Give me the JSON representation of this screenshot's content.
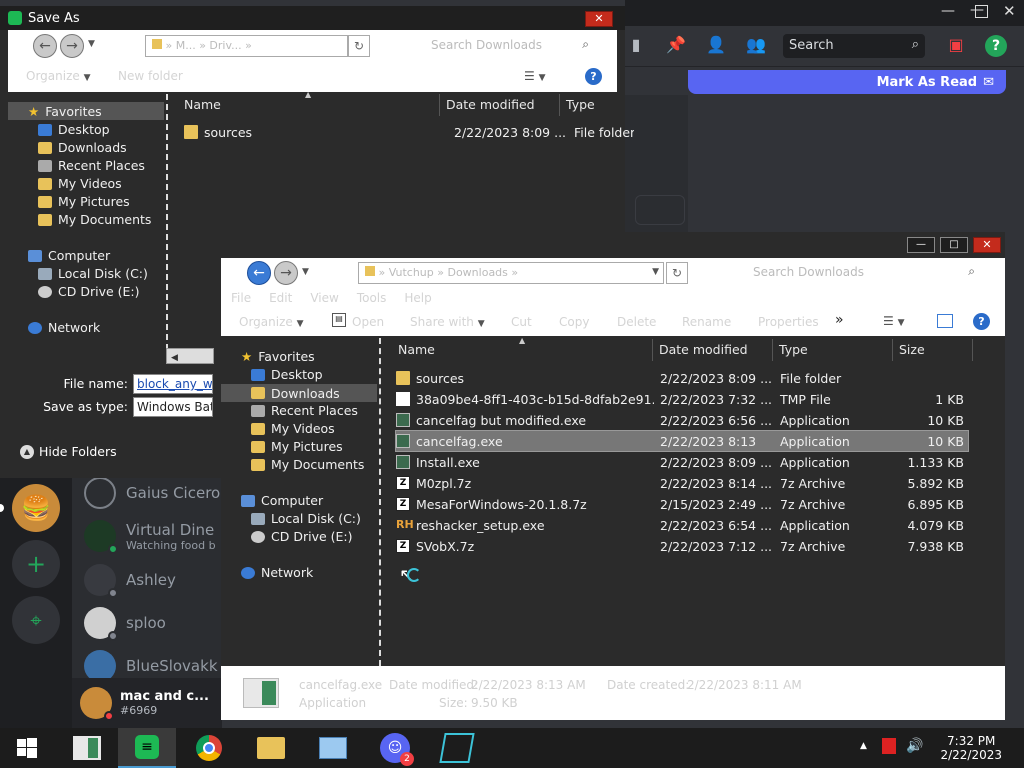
{
  "discord": {
    "search_placeholder": "Search",
    "mark_as_read": "Mark As Read",
    "dms": [
      {
        "name": "Gaius Cicero",
        "sub": ""
      },
      {
        "name": "Virtual Dine",
        "sub": "Watching food b"
      },
      {
        "name": "Ashley",
        "sub": ""
      },
      {
        "name": "sploo",
        "sub": ""
      },
      {
        "name": "BlueSlovakk",
        "sub": ""
      }
    ],
    "user": {
      "name": "mac and c...",
      "tag": "#6969"
    },
    "colors": {
      "accent": "#5865f2",
      "online": "#23a55a"
    }
  },
  "saveas": {
    "title": "Save As",
    "address": "» M... » Driv... »",
    "search_placeholder": "Search Downloads",
    "organize": "Organize",
    "new_folder": "New folder",
    "nav": {
      "favorites": "Favorites",
      "items": [
        "Desktop",
        "Downloads",
        "Recent Places",
        "My Videos",
        "My Pictures",
        "My Documents"
      ],
      "computer": "Computer",
      "drives": [
        "Local Disk (C:)",
        "CD Drive (E:)"
      ],
      "network": "Network"
    },
    "columns": {
      "name": "Name",
      "date": "Date modified",
      "type": "Type"
    },
    "files": [
      {
        "name": "sources",
        "date": "2/22/2023 8:09 ...",
        "type": "File folder"
      }
    ],
    "file_name_label": "File name:",
    "file_name_value": "block_any_we",
    "save_as_type_label": "Save as type:",
    "save_as_type_value": "Windows Batc",
    "hide_folders": "Hide Folders"
  },
  "explorer": {
    "address": "» Vutchup » Downloads »",
    "search_placeholder": "Search Downloads",
    "menu": [
      "File",
      "Edit",
      "View",
      "Tools",
      "Help"
    ],
    "toolbar": [
      "Organize",
      "Open",
      "Share with",
      "Cut",
      "Copy",
      "Delete",
      "Rename",
      "Properties"
    ],
    "more": "»",
    "nav": {
      "favorites": "Favorites",
      "items": [
        "Desktop",
        "Downloads",
        "Recent Places",
        "My Videos",
        "My Pictures",
        "My Documents"
      ],
      "computer": "Computer",
      "drives": [
        "Local Disk (C:)",
        "CD Drive (E:)"
      ],
      "network": "Network"
    },
    "columns": {
      "name": "Name",
      "date": "Date modified",
      "type": "Type",
      "size": "Size"
    },
    "files": [
      {
        "name": "sources",
        "date": "2/22/2023 8:09 ...",
        "type": "File folder",
        "size": "",
        "icon": "folder-icon"
      },
      {
        "name": "38a09be4-8ff1-403c-b15d-8dfab2e91...",
        "date": "2/22/2023 7:32 ...",
        "type": "TMP File",
        "size": "1 KB",
        "icon": "document-icon"
      },
      {
        "name": "cancelfag but modified.exe",
        "date": "2/22/2023 6:56 ...",
        "type": "Application",
        "size": "10 KB",
        "icon": "application-icon"
      },
      {
        "name": "cancelfag.exe",
        "date": "2/22/2023 8:13",
        "type": "Application",
        "size": "10 KB",
        "icon": "application-icon",
        "selected": true
      },
      {
        "name": "Install.exe",
        "date": "2/22/2023 8:09 ...",
        "type": "Application",
        "size": "1.133 KB",
        "icon": "application-icon"
      },
      {
        "name": "M0zpl.7z",
        "date": "2/22/2023 8:14 ...",
        "type": "7z Archive",
        "size": "5.892 KB",
        "icon": "archive-icon"
      },
      {
        "name": "MesaForWindows-20.1.8.7z",
        "date": "2/15/2023 2:49 ...",
        "type": "7z Archive",
        "size": "6.895 KB",
        "icon": "archive-icon"
      },
      {
        "name": "reshacker_setup.exe",
        "date": "2/22/2023 6:54 ...",
        "type": "Application",
        "size": "4.079 KB",
        "icon": "reshacker-icon"
      },
      {
        "name": "SVobX.7z",
        "date": "2/22/2023 7:12 ...",
        "type": "7z Archive",
        "size": "7.938 KB",
        "icon": "archive-icon"
      }
    ],
    "details": {
      "filename": "cancelfag.exe",
      "modified_label": "Date modified:",
      "modified_value": "2/22/2023 8:13 AM",
      "created_label": "Date created:",
      "created_value": "2/22/2023 8:11 AM",
      "type": "Application",
      "size_label": "Size:",
      "size_value": "9.50 KB"
    }
  },
  "taskbar": {
    "time": "7:32 PM",
    "date": "2/22/2023",
    "discord_badge": "2"
  }
}
